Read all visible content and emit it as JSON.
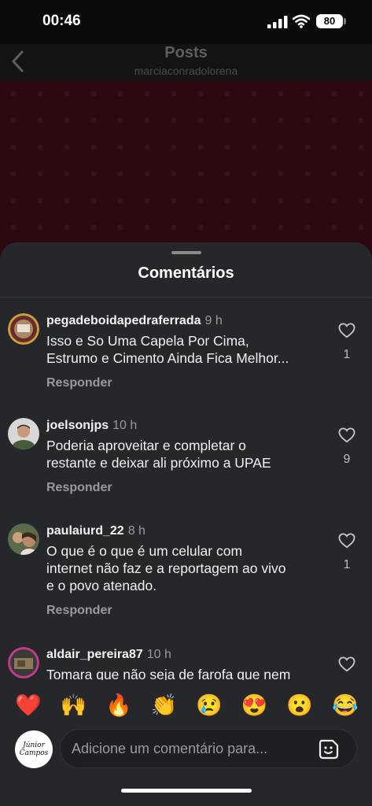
{
  "status_bar": {
    "time": "00:46",
    "battery": "80"
  },
  "header": {
    "title": "Posts",
    "subtitle": "marciaconradolorena"
  },
  "sheet": {
    "title": "Comentários",
    "reply_label": "Responder",
    "comments": [
      {
        "username": "pegadeboidapedraferrada",
        "time": "9 h",
        "text": "Isso e So Uma Capela Por Cima,\nEstrumo e Cimento Ainda Fica Melhor...",
        "likes": "1"
      },
      {
        "username": "joelsonjps",
        "time": "10 h",
        "text": "Poderia aproveitar e completar o\nrestante e deixar ali próximo a UPAE",
        "likes": "9"
      },
      {
        "username": "paulaiurd_22",
        "time": "8 h",
        "text": "O que é o que é um celular com\ninternet não faz e a reportagem ao vivo\ne o povo atenado.",
        "likes": "1"
      },
      {
        "username": "aldair_pereira87",
        "time": "10 h",
        "text": "Tomara que não seja de farofa que nem",
        "likes": ""
      }
    ]
  },
  "emoji_bar": [
    "❤️",
    "🙌",
    "🔥",
    "👏",
    "😢",
    "😍",
    "😮",
    "😂"
  ],
  "composer": {
    "placeholder": "Adicione um comentário para...",
    "avatar_logo": "Júnior Campos"
  },
  "icons": {
    "back": "chevron-left-icon",
    "like": "heart-outline-icon",
    "sticker": "sticker-icon"
  }
}
